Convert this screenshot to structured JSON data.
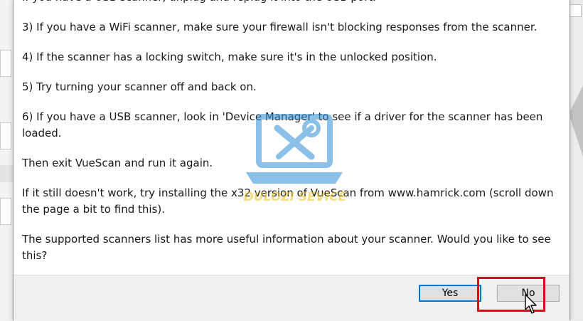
{
  "dialog": {
    "partial_line": "If you have a USB scanner, unplug and replug it into the USB port.",
    "paragraphs": [
      "3) If you have a WiFi scanner, make sure your firewall isn't blocking responses from the scanner.",
      "4) If the scanner has a locking switch, make sure it's in the unlocked position.",
      "5) Try turning your scanner off and back on.",
      "6) If you have a USB scanner, look in 'Device Manager' to see if a driver for the scanner has been loaded.",
      "Then exit VueScan and run it again.",
      "If it still doesn't work, try installing the x32 version of VueScan from www.hamrick.com (scroll down the page a bit to find this).",
      "The supported scanners list has more useful information about your scanner. Would you like to see this?"
    ],
    "buttons": {
      "yes_label": "Yes",
      "no_label": "No"
    }
  },
  "watermark": {
    "text": "DULOZI SEVICE"
  },
  "colors": {
    "highlight": "#e1061b",
    "focus": "#0078d7",
    "watermark_blue": "#2d8fd6",
    "watermark_yellow": "#e8c21a"
  },
  "icons": {
    "watermark": "laptop-wrench-screwdriver-icon",
    "cursor": "mouse-pointer-icon"
  }
}
